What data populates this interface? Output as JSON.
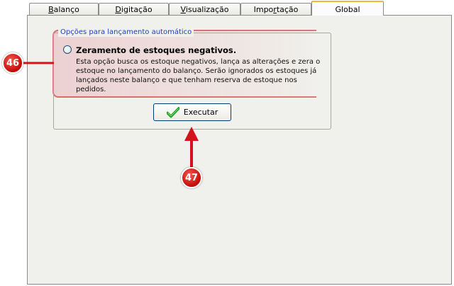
{
  "tabs": [
    {
      "label_u": "B",
      "label_rest": "alanço"
    },
    {
      "label_u": "D",
      "label_rest": "igitação"
    },
    {
      "label_u": "V",
      "label_rest": "isualização"
    },
    {
      "label_u": "",
      "label_pre": "Impo",
      "label_ul": "r",
      "label_rest": "tação"
    },
    {
      "label": "Global",
      "active": true
    }
  ],
  "group": {
    "legend": "Opções para lançamento automático",
    "option_title": "Zeramento de estoques negativos.",
    "option_desc_1": "Esta opção busca os estoque negativos,  lança as alterações e zera o",
    "option_desc_2": "estoque no lançamento do balanço. Serão ignorados os estoques já",
    "option_desc_3": "lançados neste balanço e que tenham reserva de estoque nos pedidos."
  },
  "button": {
    "label": "Executar",
    "icon": "check-icon"
  },
  "callouts": {
    "first": "46",
    "second": "47"
  },
  "colors": {
    "highlight": "#d4121c",
    "legend": "#1c3fc0",
    "tab_accent": "#f5b53b"
  }
}
